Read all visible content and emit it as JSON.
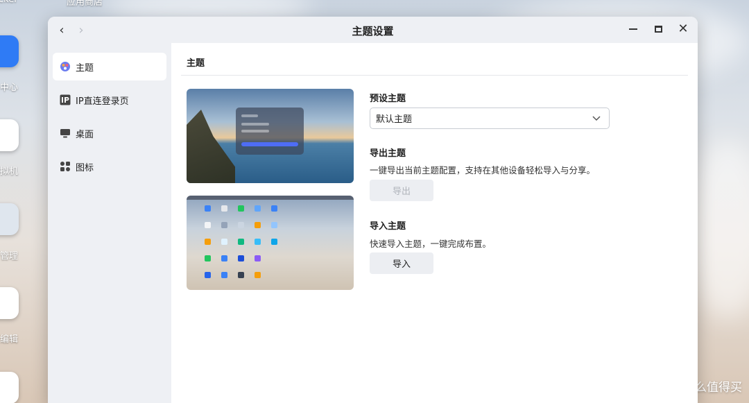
{
  "window": {
    "title": "主题设置",
    "back_label": "‹",
    "forward_label": "›"
  },
  "desktop": {
    "labels": [
      "cker",
      "应用商店",
      "中心",
      "拟机",
      "管理",
      "编辑"
    ]
  },
  "sidebar": {
    "items": [
      {
        "label": "主题",
        "icon": "theme-icon"
      },
      {
        "label": "IP直连登录页",
        "icon": "ip-icon"
      },
      {
        "label": "桌面",
        "icon": "monitor-icon"
      },
      {
        "label": "图标",
        "icon": "grid-icon"
      }
    ]
  },
  "main": {
    "section_title": "主题",
    "preset": {
      "label": "预设主题",
      "selected": "默认主题"
    },
    "export": {
      "label": "导出主题",
      "description": "一键导出当前主题配置，支持在其他设备轻松导入与分享。",
      "button": "导出"
    },
    "import": {
      "label": "导入主题",
      "description": "快速导入主题，一键完成布置。",
      "button": "导入"
    }
  },
  "watermark": {
    "logo_text": "值",
    "text": "什么值得买"
  },
  "colors": {
    "accent": "#4e6df5",
    "sidebar_bg": "#eef0f4"
  }
}
